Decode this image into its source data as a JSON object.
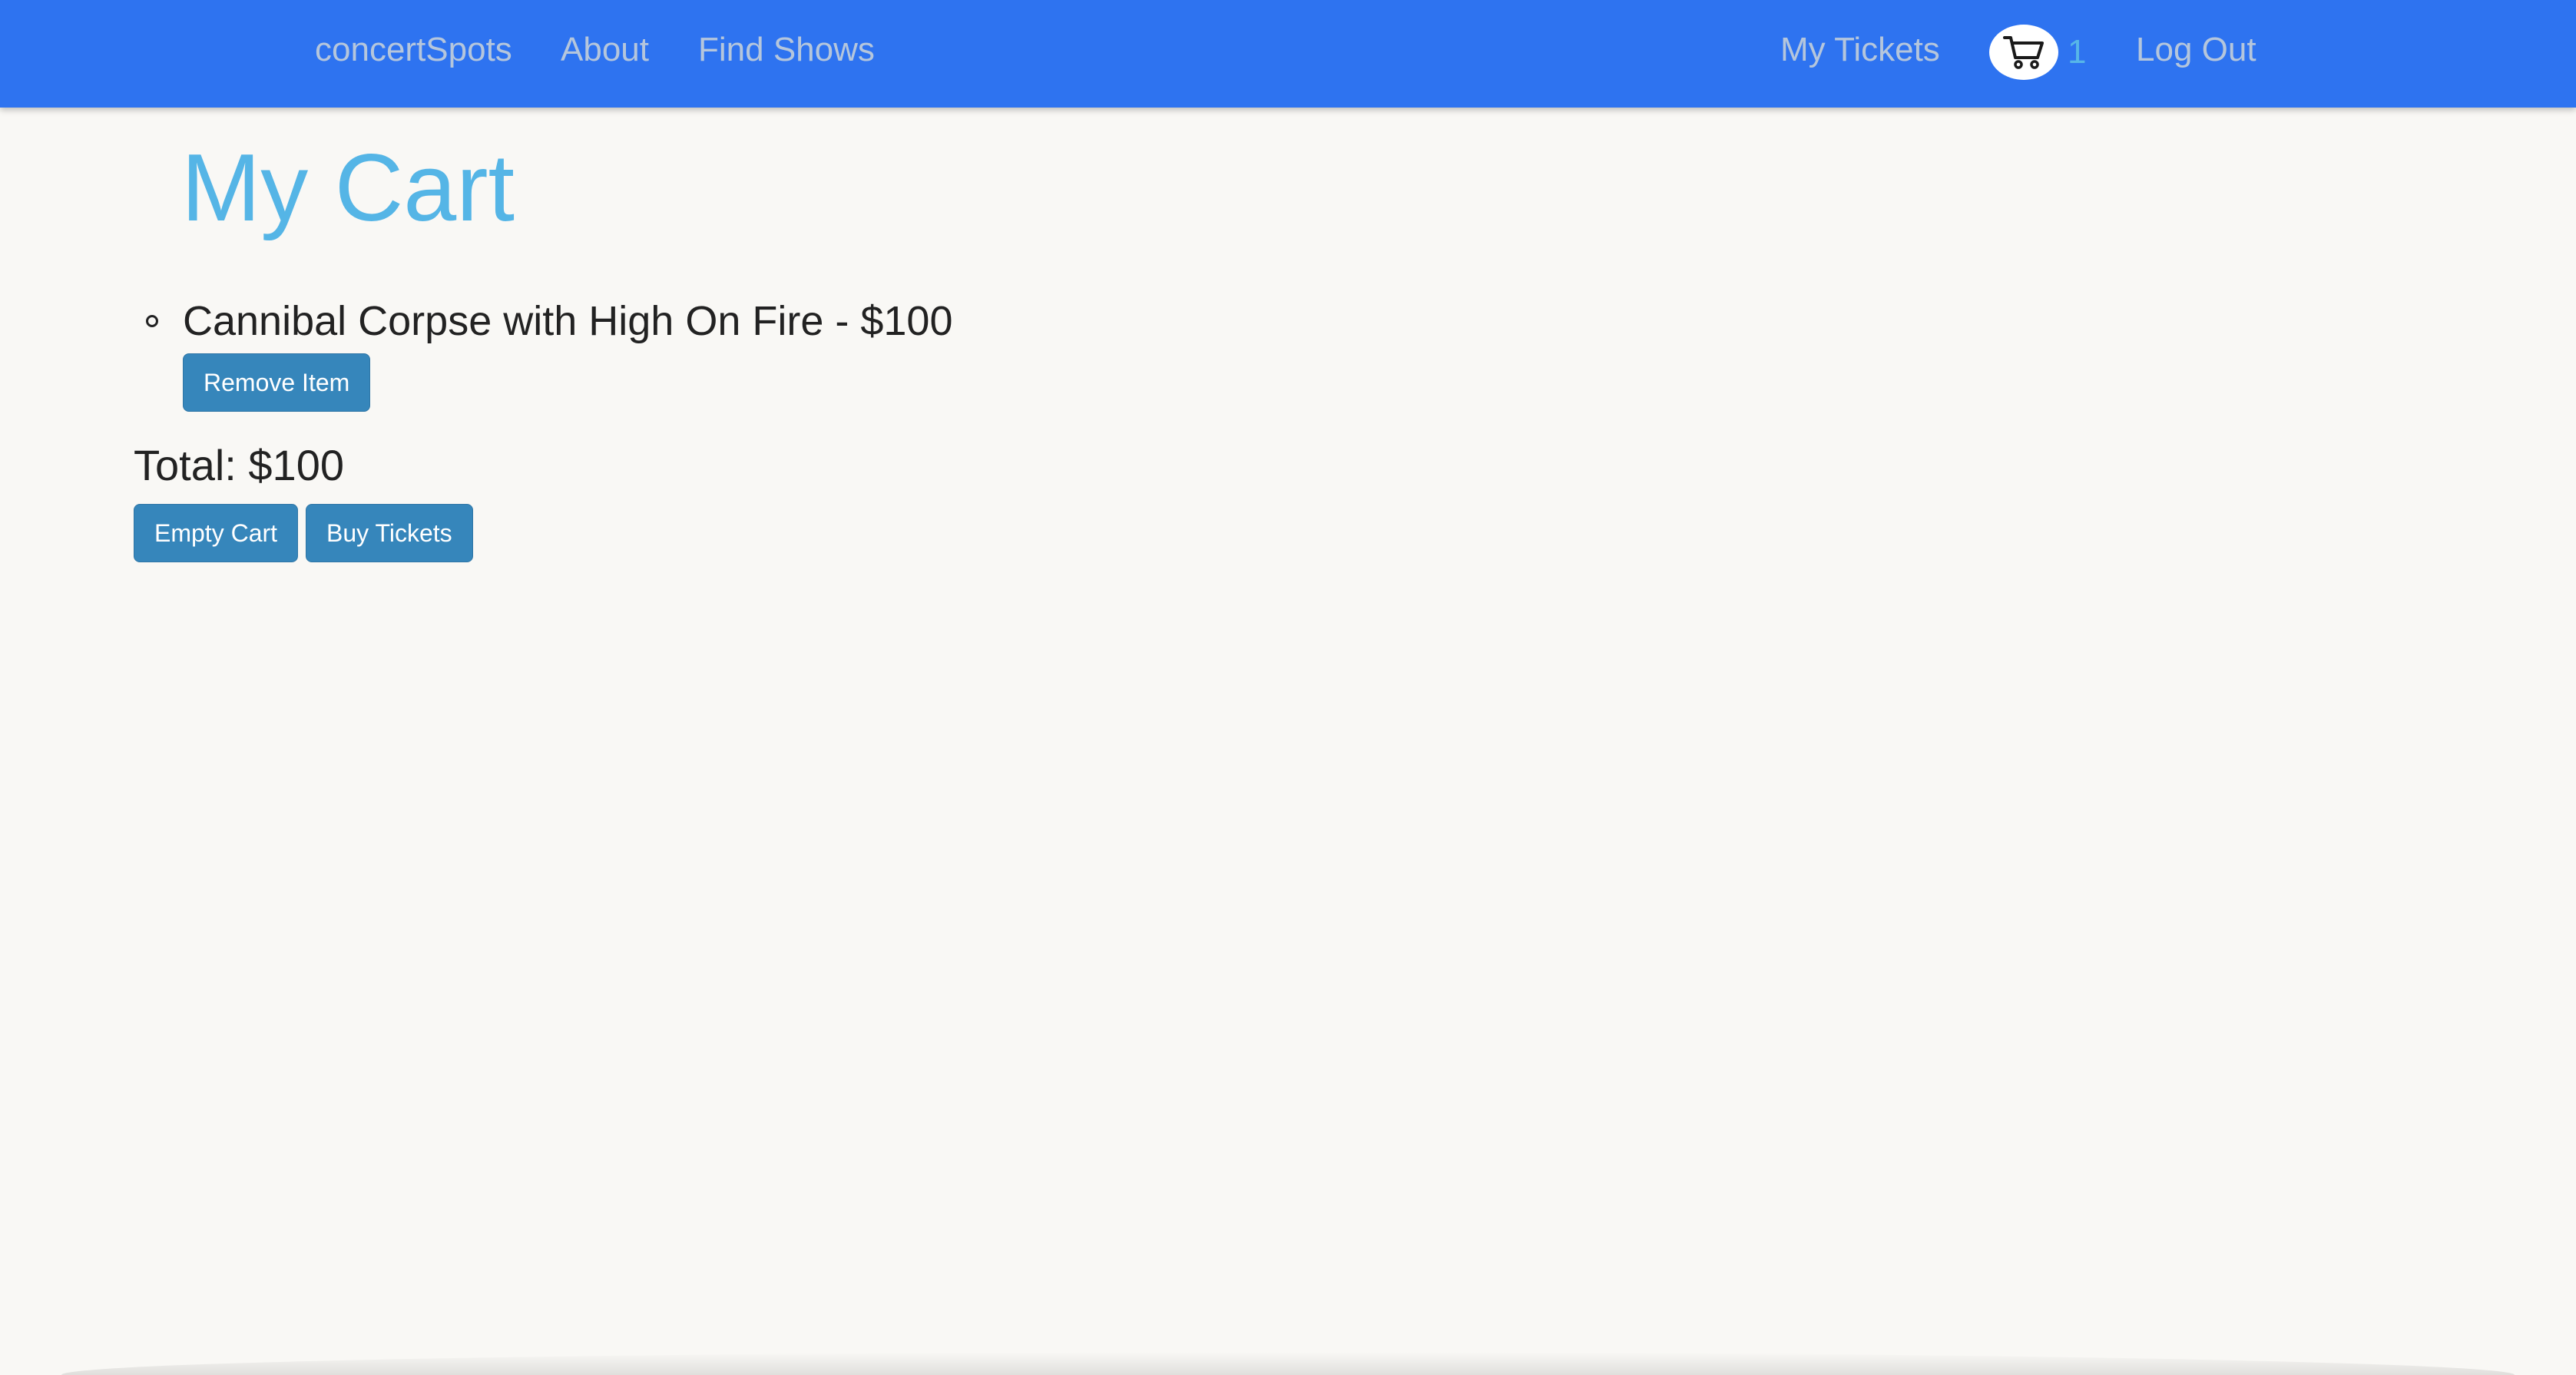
{
  "navbar": {
    "brand": "concertSpots",
    "about": "About",
    "find_shows": "Find Shows",
    "my_tickets": "My Tickets",
    "cart_icon": "shopping-cart-icon",
    "cart_count": "1",
    "log_out": "Log Out"
  },
  "page": {
    "title": "My Cart"
  },
  "cart": {
    "items": [
      {
        "text": "Cannibal Corpse with High On Fire - $100",
        "remove_label": "Remove Item"
      }
    ],
    "total": "Total: $100",
    "empty_label": "Empty Cart",
    "buy_label": "Buy Tickets"
  },
  "colors": {
    "navbar_bg": "#2e73f0",
    "nav_link": "#b5c6dc",
    "title": "#55b5e6",
    "button": "#3686bb",
    "page_bg": "#f9f8f5"
  }
}
